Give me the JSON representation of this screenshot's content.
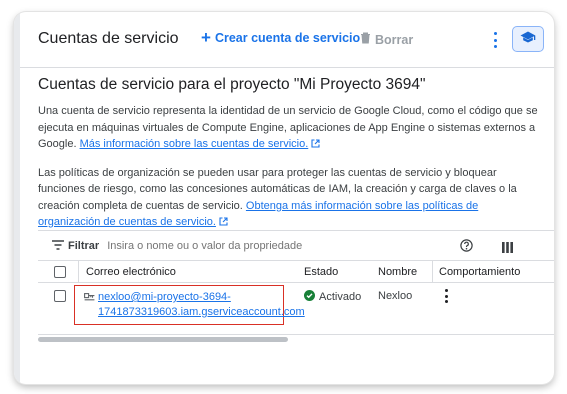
{
  "header": {
    "title": "Cuentas de servicio",
    "create_label": "Crear cuenta de servicio",
    "delete_label": "Borrar"
  },
  "main": {
    "page_title": "Cuentas de servicio para el proyecto \"Mi Proyecto 3694\"",
    "intro_text": "Una cuenta de servicio representa la identidad de un servicio de Google Cloud, como el código que se ejecuta en máquinas virtuales de Compute Engine, aplicaciones de App Engine o sistemas externos a Google.",
    "intro_link": "Más información sobre las cuentas de servicio.",
    "policy_text": "Las políticas de organización se pueden usar para proteger las cuentas de servicio y bloquear funciones de riesgo, como las concesiones automáticas de IAM, la creación y carga de claves o la creación completa de cuentas de servicio.",
    "policy_link": "Obtenga más información sobre las políticas de organización de cuentas de servicio."
  },
  "table": {
    "filter_label": "Filtrar",
    "filter_placeholder": "Insira o nome ou o valor da propriedade",
    "columns": [
      "Correo electrónico",
      "Estado",
      "Nombre",
      "Comportamiento"
    ],
    "rows": [
      {
        "email": "nexloo@mi-proyecto-3694-1741873319603.iam.gserviceaccount.com",
        "status": "Activado",
        "name": "Nexloo"
      }
    ]
  },
  "colors": {
    "accent": "#1a73e8",
    "status_ok": "#188038",
    "highlight": "#d93025"
  }
}
